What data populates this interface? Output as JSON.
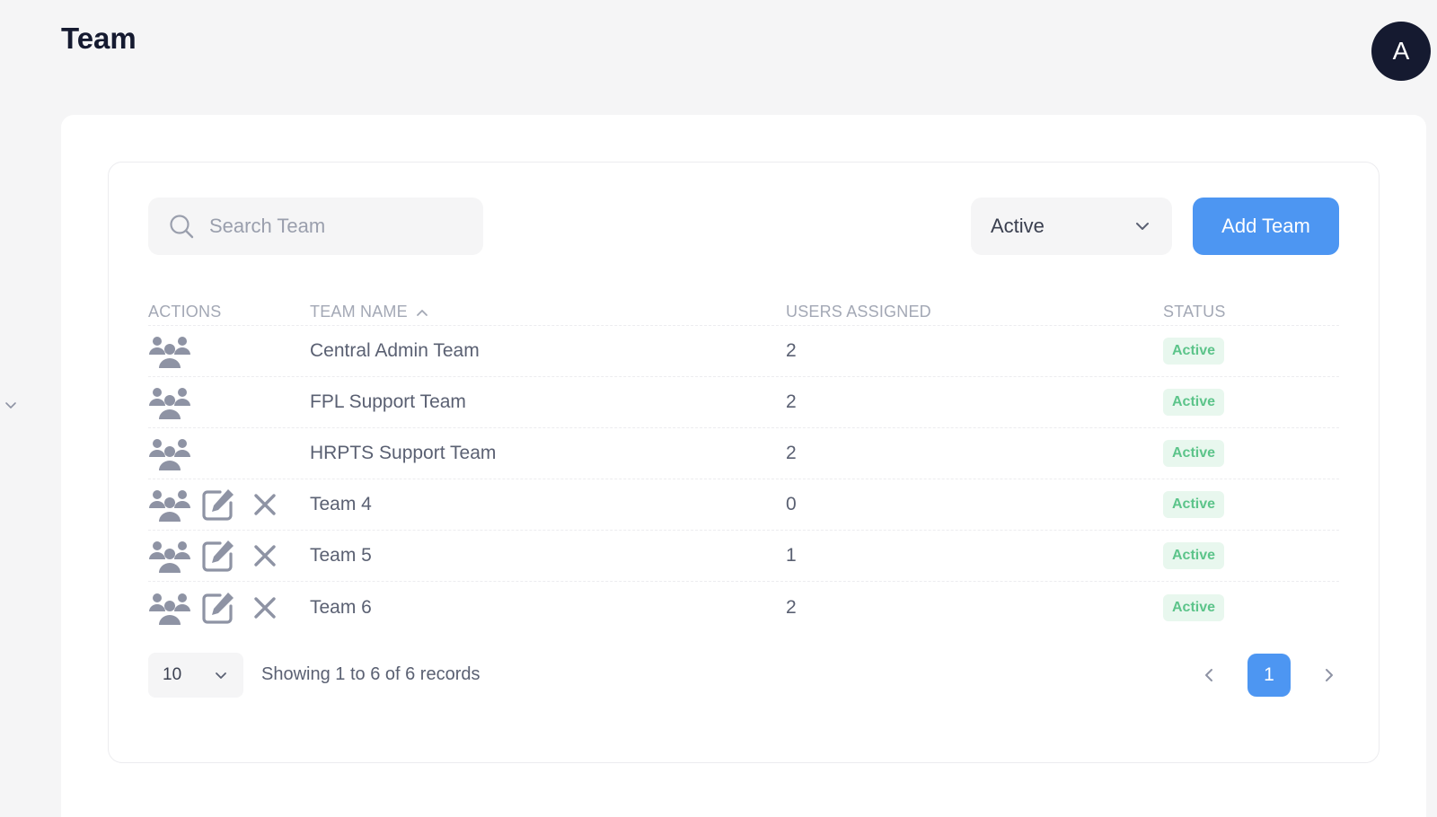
{
  "header": {
    "title": "Team",
    "avatar_initial": "A"
  },
  "toolbar": {
    "search_placeholder": "Search Team",
    "status_filter": "Active",
    "add_button": "Add Team"
  },
  "table": {
    "columns": {
      "actions": "ACTIONS",
      "team_name": "TEAM NAME",
      "users_assigned": "USERS ASSIGNED",
      "status": "STATUS"
    },
    "rows": [
      {
        "name": "Central Admin Team",
        "users": "2",
        "status": "Active",
        "editable": false
      },
      {
        "name": "FPL Support Team",
        "users": "2",
        "status": "Active",
        "editable": false
      },
      {
        "name": "HRPTS Support Team",
        "users": "2",
        "status": "Active",
        "editable": false
      },
      {
        "name": "Team 4",
        "users": "0",
        "status": "Active",
        "editable": true
      },
      {
        "name": "Team 5",
        "users": "1",
        "status": "Active",
        "editable": true
      },
      {
        "name": "Team 6",
        "users": "2",
        "status": "Active",
        "editable": true
      }
    ]
  },
  "footer": {
    "page_size": "10",
    "records_text": "Showing 1 to 6 of 6 records",
    "current_page": "1"
  },
  "colors": {
    "accent": "#4d96f2",
    "badge_bg": "#e8f7ee",
    "badge_text": "#5cc48a",
    "icon": "#8e93a4"
  }
}
